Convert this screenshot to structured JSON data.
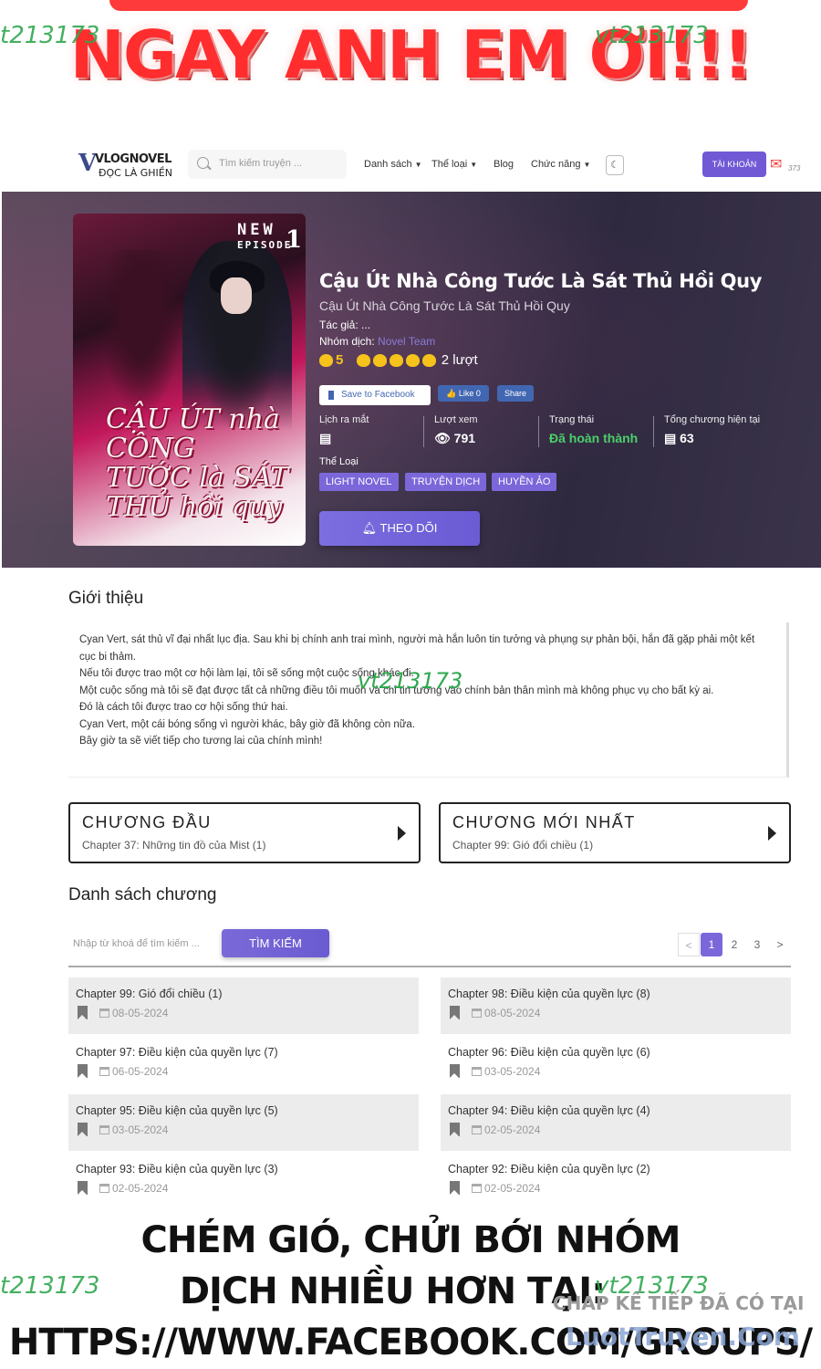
{
  "top_banner": {
    "text": "NGAY ANH EM ƠI!!!"
  },
  "watermarks": {
    "text": "vt213173",
    "left_text": "t213173"
  },
  "nav": {
    "logo_line1": "VLOGNOVEL",
    "logo_line2": "ĐỌC LÀ GHIỀN",
    "search_placeholder": "Tìm kiếm truyện ...",
    "menu": [
      "Danh sách",
      "Thể loại",
      "Blog",
      "Chức năng"
    ],
    "account_label": "TÀI KHOẢN",
    "notification_count": "373"
  },
  "hero": {
    "cover": {
      "badge_top": "NEW",
      "badge_bottom": "EPISODE",
      "badge_num": "1",
      "title_text": "CẬU ÚT nhà CÔNG TƯỚC là SÁT THỦ hồi quy"
    },
    "title": "Cậu Út Nhà Công Tước Là Sát Thủ Hồi Quy",
    "subtitle": "Cậu Út Nhà Công Tước Là Sát Thủ Hồi Quy",
    "author_label": "Tác giả: ...",
    "team_label": "Nhóm dịch:",
    "team_name": "Novel Team",
    "rating_value": "5",
    "rating_stars": 5,
    "rating_count": "2 lượt",
    "fb_save": "Save to Facebook",
    "fb_like": "Like 0",
    "fb_share": "Share",
    "stats": [
      {
        "label": "Lịch ra mắt",
        "value": ""
      },
      {
        "label": "Lượt xem",
        "value": "791"
      },
      {
        "label": "Trạng thái",
        "value": "Đã hoàn thành"
      },
      {
        "label": "Tổng chương hiện tại",
        "value": "63"
      }
    ],
    "genre_label": "Thể Loại",
    "genres": [
      "LIGHT NOVEL",
      "TRUYỆN DỊCH",
      "HUYỀN ẢO"
    ],
    "follow_label": "THEO DÕI"
  },
  "intro": {
    "title": "Giới thiệu",
    "paragraphs": [
      "Cyan Vert, sát thủ vĩ đại nhất lục địa. Sau khi bị chính anh trai mình, người mà hắn luôn tin tưởng và phụng sự phản bội, hắn đã gặp phải một kết cục bi thảm.",
      "Nếu tôi được trao một cơ hội làm lại, tôi sẽ sống một cuộc sống khác đi.",
      "Một cuộc sống mà tôi sẽ đạt được tất cả những điều tôi muốn và chỉ tin tưởng vào chính bản thân mình mà không phục vụ cho bất kỳ ai.",
      "Đó là cách tôi được trao cơ hội sống thứ hai.",
      "Cyan Vert, một cái bóng sống vì người khác, bây giờ đã không còn nữa.",
      "Bây giờ ta sẽ viết tiếp cho tương lai của chính mình!"
    ]
  },
  "first_chapter": {
    "title": "CHƯƠNG ĐẦU",
    "sub": "Chapter 37: Những tin đồ của Mist (1)"
  },
  "latest_chapter": {
    "title": "CHƯƠNG MỚI NHẤT",
    "sub": "Chapter 99: Gió đổi chiều (1)"
  },
  "chapter_list": {
    "title": "Danh sách chương",
    "search_placeholder": "Nhập từ khoá để tìm kiếm ...",
    "search_button": "TÌM KIẾM",
    "pages": [
      "<",
      "1",
      "2",
      "3",
      ">"
    ],
    "active_page": "1",
    "rows": [
      {
        "title": "Chapter 99: Gió đổi chiều (1)",
        "date": "08-05-2024"
      },
      {
        "title": "Chapter 98: Điều kiện của quyền lực (8)",
        "date": "08-05-2024"
      },
      {
        "title": "Chapter 97: Điều kiện của quyền lực (7)",
        "date": "06-05-2024"
      },
      {
        "title": "Chapter 96: Điều kiện của quyền lực (6)",
        "date": "03-05-2024"
      },
      {
        "title": "Chapter 95: Điều kiện của quyền lực (5)",
        "date": "03-05-2024"
      },
      {
        "title": "Chapter 94: Điều kiện của quyền lực (4)",
        "date": "02-05-2024"
      },
      {
        "title": "Chapter 93: Điều kiện của quyền lực (3)",
        "date": "02-05-2024"
      },
      {
        "title": "Chapter 92: Điều kiện của quyền lực (2)",
        "date": "02-05-2024"
      }
    ]
  },
  "bottom_banner": {
    "line1": "CHÉM GIÓ, CHỬI BỚI NHÓM",
    "line2": "DỊCH NHIỀU HƠN TẠI:",
    "line3": "HTTPS://WWW.FACEBOOK.COM/GROUPS/",
    "next_chapter": "CHAP KẾ TIẾP ĐÃ CÓ TẠI",
    "site_logo": "LuotTruyen.Com"
  },
  "colors": {
    "accent": "#7b67d9",
    "banner_red": "#ff2d2d",
    "status_green": "#4ccf6a",
    "rating_gold": "#f6c21c",
    "watermark_green": "#2fa84f"
  }
}
